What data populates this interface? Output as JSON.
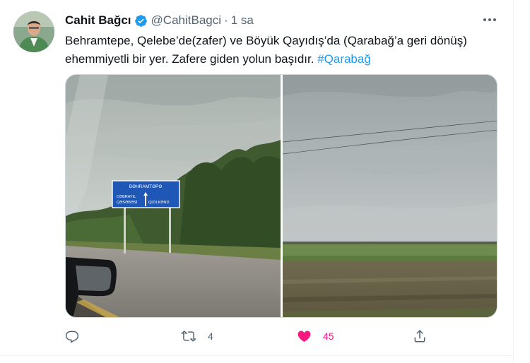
{
  "tweet": {
    "author_name": "Cahit Bağcı",
    "handle": "@CahitBagci",
    "separator": "·",
    "time": "1 sa",
    "text_main": "Behramtepe, Qelebe’de(zafer) ve Böyük Qayıdış’da (Qarabağ’a geri dönüş) ehemmiyetli bir yer. Zafere giden yolun başıdır. ",
    "hashtag": "#Qarabağ"
  },
  "media": {
    "sign_line1": "BƏHRAMTƏPƏ",
    "sign_line2": "CƏBRAYIL",
    "sign_line3": "QƏSƏBƏSİ",
    "sign_line4": "QIZILKƏND"
  },
  "actions": {
    "reply_icon": "reply-icon",
    "retweet_icon": "retweet-icon",
    "retweet_count": "4",
    "like_icon": "heart-icon",
    "like_count": "45",
    "share_icon": "share-icon"
  },
  "colors": {
    "accent": "#1d9bf0",
    "like": "#f91880",
    "secondary_text": "#536471"
  }
}
